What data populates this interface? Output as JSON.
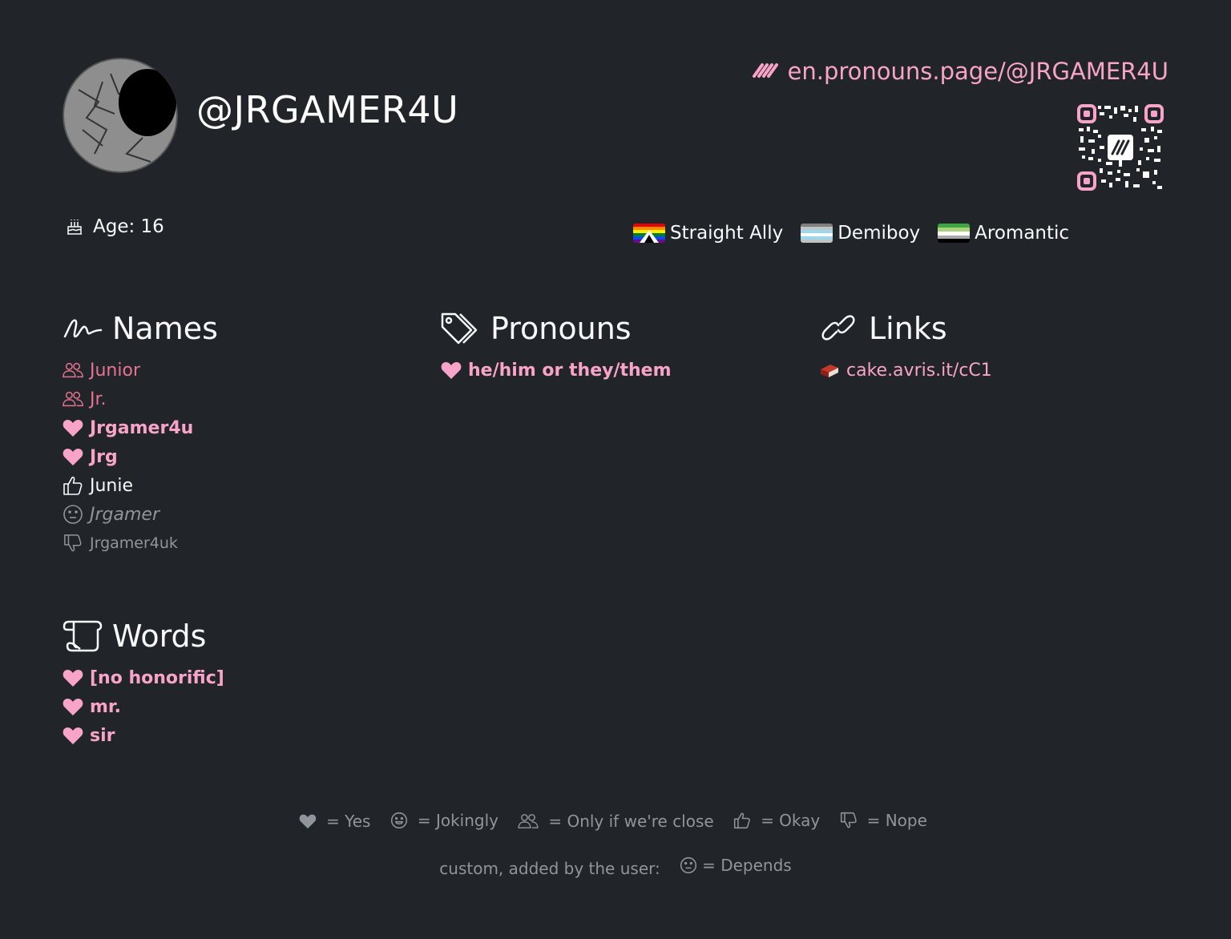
{
  "profile": {
    "username": "@JRGAMER4U",
    "url": "en.pronouns.page/@JRGAMER4U",
    "age_label": "Age: 16"
  },
  "flags": [
    {
      "label": "Straight Ally"
    },
    {
      "label": "Demiboy"
    },
    {
      "label": "Aromantic"
    }
  ],
  "names": {
    "title": "Names",
    "items": [
      {
        "label": "Junior",
        "opinion": "close"
      },
      {
        "label": "Jr.",
        "opinion": "close"
      },
      {
        "label": "Jrgamer4u",
        "opinion": "yes"
      },
      {
        "label": "Jrg",
        "opinion": "yes"
      },
      {
        "label": "Junie",
        "opinion": "okay"
      },
      {
        "label": "Jrgamer",
        "opinion": "depends"
      },
      {
        "label": "Jrgamer4uk",
        "opinion": "nope"
      }
    ]
  },
  "pronouns": {
    "title": "Pronouns",
    "items": [
      {
        "label": "he/him or they/them",
        "opinion": "yes"
      }
    ]
  },
  "links": {
    "title": "Links",
    "items": [
      {
        "label": "cake.avris.it/cC1"
      }
    ]
  },
  "words": {
    "title": "Words",
    "items": [
      {
        "label": "[no honorific]",
        "opinion": "yes"
      },
      {
        "label": "mr.",
        "opinion": "yes"
      },
      {
        "label": "sir",
        "opinion": "yes"
      }
    ]
  },
  "legend": {
    "yes": "= Yes",
    "jokingly": "= Jokingly",
    "close": "= Only if we're close",
    "okay": "= Okay",
    "nope": "= Nope",
    "custom_prefix": "custom, added by the user:",
    "depends": "= Depends"
  },
  "colors": {
    "background": "#212529",
    "accent": "#f8a4c8",
    "close": "#e8738f",
    "muted": "#8f959b"
  }
}
